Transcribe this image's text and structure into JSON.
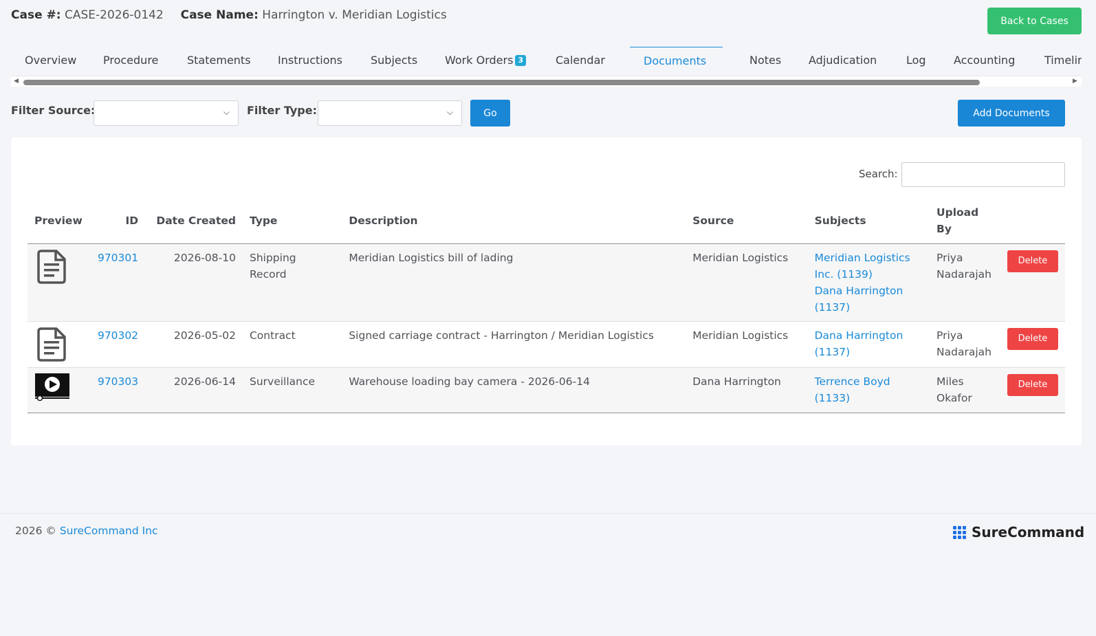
{
  "header": {
    "case_number_label": "Case #:",
    "case_number": "CASE-2026-0142",
    "case_name_label": "Case Name:",
    "case_name": "Harrington v. Meridian Logistics",
    "back_button": "Back to Cases"
  },
  "tabs": [
    {
      "label": "Overview"
    },
    {
      "label": "Procedure"
    },
    {
      "label": "Statements"
    },
    {
      "label": "Instructions"
    },
    {
      "label": "Subjects"
    },
    {
      "label": "Work Orders",
      "badge": "3"
    },
    {
      "label": "Calendar"
    },
    {
      "label": "Documents",
      "active": true
    },
    {
      "label": "Notes"
    },
    {
      "label": "Adjudication"
    },
    {
      "label": "Log"
    },
    {
      "label": "Accounting"
    },
    {
      "label": "Timeline"
    }
  ],
  "filters": {
    "source_label": "Filter Source:",
    "source_value": "",
    "type_label": "Filter Type:",
    "type_value": "",
    "go_button": "Go",
    "add_button": "Add Documents"
  },
  "search": {
    "label": "Search:",
    "value": ""
  },
  "table": {
    "headers": {
      "preview": "Preview",
      "id": "ID",
      "date": "Date Created",
      "type": "Type",
      "description": "Description",
      "source": "Source",
      "subjects": "Subjects",
      "upload_by": "Upload By"
    },
    "rows": [
      {
        "preview_icon": "document-icon",
        "id": "970301",
        "date": "2026-08-10",
        "type": "Shipping Record",
        "description": "Meridian Logistics bill of lading",
        "source": "Meridian Logistics",
        "subjects": [
          "Meridian Logistics Inc. (1139)",
          "Dana Harrington (1137)"
        ],
        "upload_by": "Priya Nadarajah",
        "delete_label": "Delete"
      },
      {
        "preview_icon": "document-icon",
        "id": "970302",
        "date": "2026-05-02",
        "type": "Contract",
        "description": "Signed carriage contract - Harrington / Meridian Logistics",
        "source": "Meridian Logistics",
        "subjects": [
          "Dana Harrington (1137)"
        ],
        "upload_by": "Priya Nadarajah",
        "delete_label": "Delete"
      },
      {
        "preview_icon": "video-icon",
        "id": "970303",
        "date": "2026-06-14",
        "type": "Surveillance",
        "description": "Warehouse loading bay camera - 2026-06-14",
        "source": "Dana Harrington",
        "subjects": [
          "Terrence Boyd (1133)"
        ],
        "upload_by": "Miles Okafor",
        "delete_label": "Delete"
      }
    ]
  },
  "footer": {
    "copyright_prefix": "2026 ©",
    "company_link": "SureCommand Inc",
    "brand_name": "SureCommand"
  },
  "colors": {
    "accent": "#1a8ad8",
    "success": "#35c071",
    "danger": "#ee4444",
    "badge": "#22a8d6"
  }
}
